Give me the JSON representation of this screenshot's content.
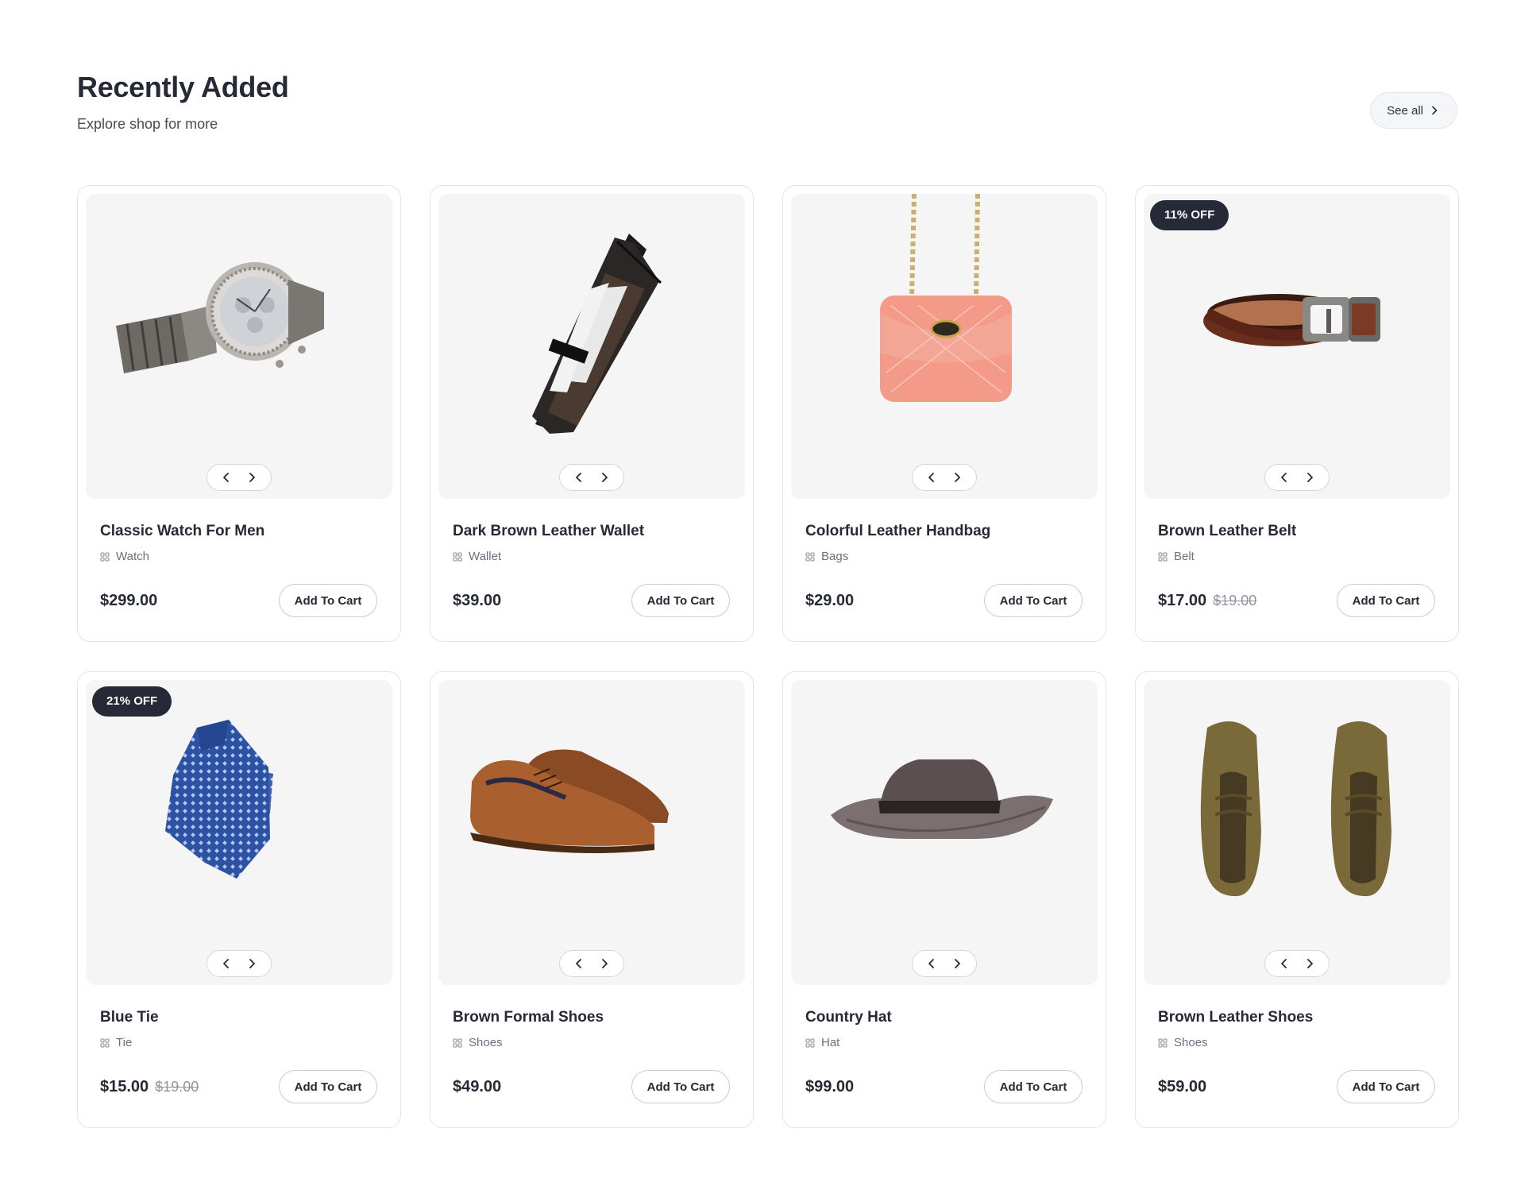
{
  "header": {
    "title": "Recently Added",
    "subtitle": "Explore shop for more",
    "see_all_label": "See all"
  },
  "products": [
    {
      "name": "Classic Watch For Men",
      "category": "Watch",
      "price": "$299.00",
      "old_price": "",
      "badge": "",
      "button": "Add To Cart",
      "image": "watch"
    },
    {
      "name": "Dark Brown Leather Wallet",
      "category": "Wallet",
      "price": "$39.00",
      "old_price": "",
      "badge": "",
      "button": "Add To Cart",
      "image": "wallet"
    },
    {
      "name": "Colorful Leather Handbag",
      "category": "Bags",
      "price": "$29.00",
      "old_price": "",
      "badge": "",
      "button": "Add To Cart",
      "image": "handbag"
    },
    {
      "name": "Brown Leather Belt",
      "category": "Belt",
      "price": "$17.00",
      "old_price": "$19.00",
      "badge": "11% OFF",
      "button": "Add To Cart",
      "image": "belt"
    },
    {
      "name": "Blue Tie",
      "category": "Tie",
      "price": "$15.00",
      "old_price": "$19.00",
      "badge": "21% OFF",
      "button": "Add To Cart",
      "image": "tie"
    },
    {
      "name": "Brown Formal Shoes",
      "category": "Shoes",
      "price": "$49.00",
      "old_price": "",
      "badge": "",
      "button": "Add To Cart",
      "image": "formal-shoes"
    },
    {
      "name": "Country Hat",
      "category": "Hat",
      "price": "$99.00",
      "old_price": "",
      "badge": "",
      "button": "Add To Cart",
      "image": "hat"
    },
    {
      "name": "Brown Leather Shoes",
      "category": "Shoes",
      "price": "$59.00",
      "old_price": "",
      "badge": "",
      "button": "Add To Cart",
      "image": "leather-shoes"
    }
  ],
  "icons": {
    "see_all": "chevron-right-icon",
    "prev": "chevron-left-icon",
    "next": "chevron-right-icon",
    "category": "category-grid-icon"
  },
  "colors": {
    "badge_bg": "#262a36",
    "image_bg": "#f5f5f5",
    "text_dark": "#262a36",
    "text_muted": "#6b7080"
  }
}
